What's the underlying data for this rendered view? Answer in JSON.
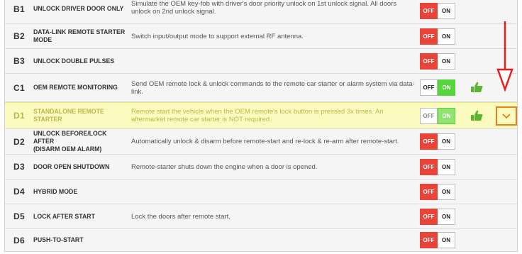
{
  "rows": [
    {
      "code": "B1",
      "name": "UNLOCK DRIVER DOOR ONLY",
      "desc": "Simulate the OEM key-fob with driver's door priority unlock on 1st unlock signal. All doors unlock on 2nd unlock signal.",
      "off": "OFF",
      "on": "ON",
      "state": "off"
    },
    {
      "code": "B2",
      "name": "DATA-LINK REMOTE STARTER MODE",
      "desc": "Switch input/output mode to support external RF antenna.",
      "off": "OFF",
      "on": "ON",
      "state": "off"
    },
    {
      "code": "B3",
      "name": "UNLOCK DOUBLE PULSES",
      "desc": "",
      "off": "OFF",
      "on": "ON",
      "state": "off"
    },
    {
      "code": "C1",
      "name": "OEM REMOTE MONITORING",
      "desc": "Send OEM remote lock & unlock commands to the remote car starter or alarm system via data-link.",
      "off": "OFF",
      "on": "ON",
      "state": "on"
    },
    {
      "code": "D1",
      "name": "STANDALONE REMOTE STARTER",
      "desc": "Remote start the vehicle when the OEM remote's lock button is pressed 3x times. An aftermarket remote car starter is NOT required.",
      "off": "OFF",
      "on": "ON",
      "state": "on"
    },
    {
      "code": "D2",
      "name": "UNLOCK BEFORE/LOCK AFTER\n(DISARM OEM ALARM)",
      "desc": "Automatically unlock & disarm before remote-start and re-lock & re-arm after remote-start.",
      "off": "OFF",
      "on": "ON",
      "state": "off"
    },
    {
      "code": "D3",
      "name": "DOOR OPEN SHUTDOWN",
      "desc": "Remote-starter shuts down the engine when a door is opened.",
      "off": "OFF",
      "on": "ON",
      "state": "off"
    },
    {
      "code": "D4",
      "name": "HYBRID MODE",
      "desc": "",
      "off": "OFF",
      "on": "ON",
      "state": "off"
    },
    {
      "code": "D5",
      "name": "LOCK AFTER START",
      "desc": "Lock the doors after remote start.",
      "off": "OFF",
      "on": "ON",
      "state": "off"
    },
    {
      "code": "D6",
      "name": "PUSH-TO-START",
      "desc": "",
      "off": "OFF",
      "on": "ON",
      "state": "off"
    }
  ],
  "colors": {
    "off_active": "#e8443a",
    "on_active": "#56d63c",
    "highlight_row": "#fbfbbf",
    "chevron_border": "#f07b1b",
    "annotation_arrow": "#e02020",
    "thumb": "#5cb531"
  },
  "icons": {
    "thumb": "thumbs-up-icon",
    "expand": "chevron-down-icon",
    "annotation": "red-arrow-down-icon"
  }
}
